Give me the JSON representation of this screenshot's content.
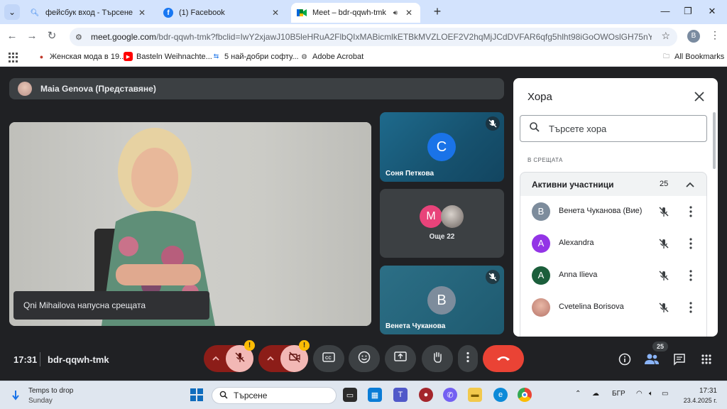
{
  "browser": {
    "tabs": [
      {
        "title": "фейсбук вход - Търсене"
      },
      {
        "title": "(1) Facebook"
      },
      {
        "title": "Meet – bdr-qqwh-tmk"
      }
    ],
    "url_host": "meet.google.com",
    "url_rest": "/bdr-qqwh-tmk?fbclid=IwY2xjawJ10B5leHRuA2FlbQIxMABicmlkETBkMVZLOEF2V2hqMjJCdDVFAR6qfg5hlht98iGoOWOslGH75nY4dn0lDPvxM...",
    "profile_initial": "B",
    "bookmarks": [
      {
        "label": "Женская мода в 19..."
      },
      {
        "label": "Basteln Weihnachte..."
      },
      {
        "label": "5 най-добри софту..."
      },
      {
        "label": "Adobe Acrobat"
      }
    ],
    "all_bookmarks": "All Bookmarks"
  },
  "meet": {
    "presenter": "Maia Genova (Представяне)",
    "toast": "Qni Mihailova напусна срещата",
    "tiles": [
      {
        "initial": "С",
        "name": "Соня Петкова",
        "color": "#1a73e8"
      },
      {
        "initial": "M",
        "more_label": "Още 22",
        "color": "#e8437a"
      },
      {
        "initial": "В",
        "name": "Венета Чуканова",
        "color": "#7d8c9c"
      }
    ],
    "time": "17:31",
    "code": "bdr-qqwh-tmk",
    "people_count": "25"
  },
  "panel": {
    "title": "Хора",
    "search_placeholder": "Търсете хора",
    "section_label": "В СРЕЩАТА",
    "group_title": "Активни участници",
    "group_count": "25",
    "participants": [
      {
        "initial": "В",
        "name": "Венета Чуканова (Вие)",
        "color": "#7d8c9c"
      },
      {
        "initial": "A",
        "name": "Alexandra",
        "color": "#9334e6"
      },
      {
        "initial": "A",
        "name": "Anna Ilieva",
        "color": "#1b5e3b"
      },
      {
        "initial": "",
        "name": "Cvetelina Borisova",
        "color": "#c98a7a"
      }
    ]
  },
  "taskbar": {
    "weather_title": "Temps to drop",
    "weather_sub": "Sunday",
    "search": "Търсене",
    "lang": "БГР",
    "time": "17:31",
    "date": "23.4.2025 г."
  }
}
